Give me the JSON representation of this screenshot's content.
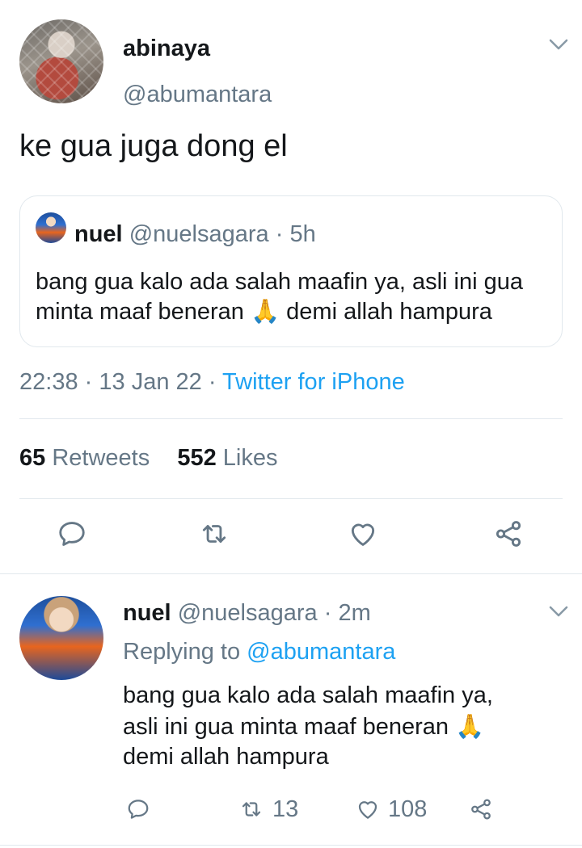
{
  "tweet": {
    "author_name": "abinaya",
    "author_handle": "@abumantara",
    "text": "ke gua juga dong el",
    "quote": {
      "author_name": "nuel",
      "author_handle": "@nuelsagara",
      "separator": "·",
      "time": "5h",
      "line1": "bang gua kalo ada salah maafin ya, asli ini gua",
      "line2a": "minta maaf beneran",
      "emoji": "🙏",
      "line2b": "demi allah hampura"
    },
    "meta": {
      "time": "22:38",
      "sep1": "·",
      "date": "13 Jan 22",
      "sep2": "·",
      "client": "Twitter for iPhone"
    },
    "stats": {
      "retweets_count": "65",
      "retweets_label": "Retweets",
      "likes_count": "552",
      "likes_label": "Likes"
    }
  },
  "reply": {
    "author_name": "nuel",
    "author_handle": "@nuelsagara",
    "separator": "·",
    "time": "2m",
    "replying_prefix": "Replying to",
    "replying_handle": "@abumantara",
    "line1": "bang gua kalo ada salah maafin ya,",
    "line2a": "asli ini gua minta maaf beneran",
    "emoji": "🙏",
    "line3": "demi allah hampura",
    "retweets": "13",
    "likes": "108"
  },
  "icons": {
    "reply": "reply-icon",
    "retweet": "retweet-icon",
    "like": "heart-icon",
    "share": "share-icon",
    "more": "chevron-down-icon"
  },
  "colors": {
    "text": "#14171a",
    "muted": "#657786",
    "link": "#1da1f2",
    "divider": "#e1e8ed"
  }
}
